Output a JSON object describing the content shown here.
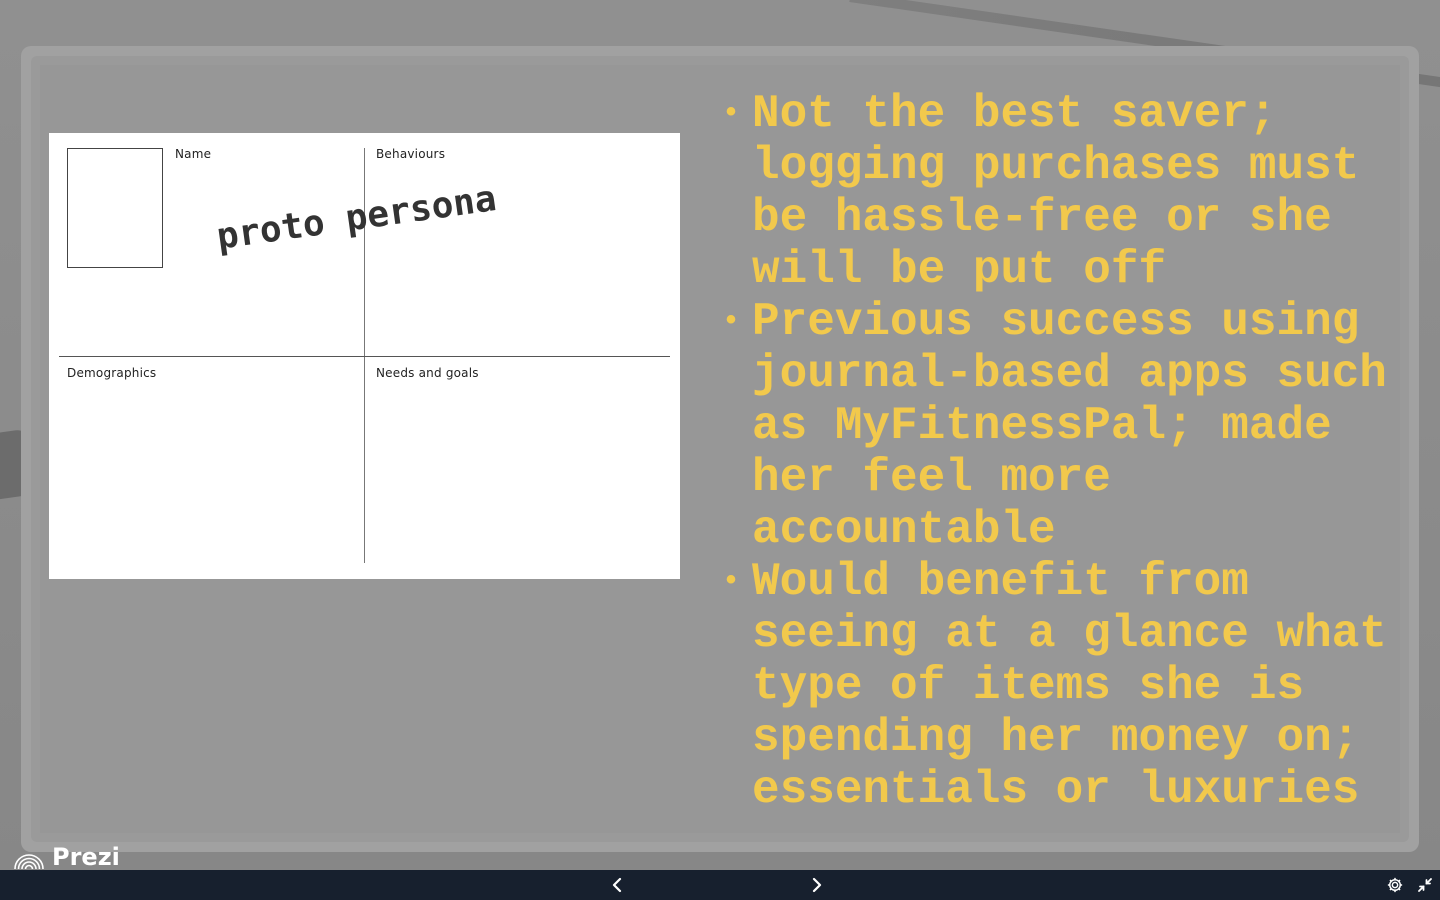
{
  "persona_card": {
    "name_label": "Name",
    "behaviours_label": "Behaviours",
    "demographics_label": "Demographics",
    "needs_label": "Needs and goals",
    "overlay_text": "proto persona"
  },
  "bullets": [
    "Not the best saver; logging purchases must be hassle-free or she will be put off",
    "Previous success using journal-based apps such as MyFitnessPal; made her feel more accountable",
    "Would benefit from seeing at a glance what type of items she is spending her money on; essentials or luxuries"
  ],
  "brand": {
    "name": "Prezi",
    "icon": "prezi-logo-icon"
  },
  "footer": {
    "prev_icon": "chevron-left-icon",
    "next_icon": "chevron-right-icon",
    "settings_icon": "gear-icon",
    "exit_fullscreen_icon": "exit-fullscreen-icon"
  },
  "colors": {
    "bullet_text": "#f2c94c",
    "footer_bg": "#17202e",
    "stage_bg": "#8a8a8a"
  }
}
